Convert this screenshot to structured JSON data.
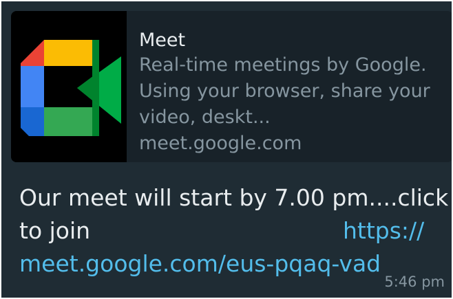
{
  "link_preview": {
    "title": "Meet",
    "description": "Real-time meetings by Google. Using your browser, share your video, deskt...",
    "domain": "meet.google.com",
    "thumbnail_icon": "google-meet-logo"
  },
  "message": {
    "text_line1": "Our meet will start by 7.00 pm....click",
    "text_line2": "to join",
    "link_part1": "https://",
    "link_part2": "meet.google.com/eus-pqaq-vad",
    "timestamp": "5:46 pm"
  },
  "colors": {
    "bubble_bg": "#1f2c34",
    "preview_bg": "#182229",
    "link": "#53bdeb",
    "text": "#e9edef",
    "muted": "#8696a0"
  }
}
